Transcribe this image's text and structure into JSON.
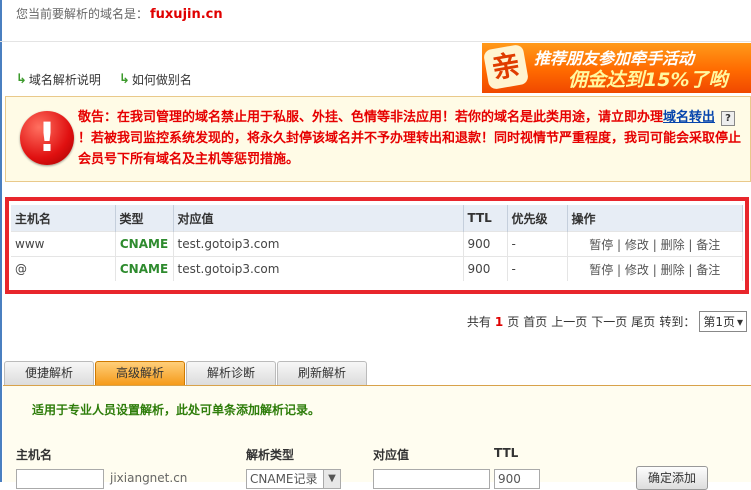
{
  "header": {
    "domain_prefix": "您当前要解析的域名是：",
    "domain": "fuxujin.cn"
  },
  "help_links": [
    {
      "label": "域名解析说明"
    },
    {
      "label": "如何做别名"
    }
  ],
  "banner": {
    "badge": "亲",
    "line1": "推荐朋友参加牵手活动",
    "line2": "佣金达到15%了哟"
  },
  "warning": {
    "part1": "敬告：在我司管理的域名禁止用于私服、外挂、色情等非法应用！若你的域名是此类用途，请立即办理",
    "link": "域名转出",
    "qmark": "?",
    "part2": "！若被我司监控系统发现的，将永久封停该域名并不予办理转出和退款！同时视情节严重程度，我司可能会采取停止会员号下所有域名及主机等惩罚措施。"
  },
  "table": {
    "headers": [
      "主机名",
      "类型",
      "对应值",
      "TTL",
      "优先级",
      "操作"
    ],
    "rows": [
      {
        "host": "www",
        "type": "CNAME",
        "value": "test.gotoip3.com",
        "ttl": "900",
        "priority": "-"
      },
      {
        "host": "@",
        "type": "CNAME",
        "value": "test.gotoip3.com",
        "ttl": "900",
        "priority": "-"
      }
    ],
    "actions": {
      "pause": "暂停",
      "edit": "修改",
      "delete": "删除",
      "note": "备注",
      "sep": " | "
    }
  },
  "pager": {
    "total_prefix": "共有",
    "total": "1",
    "total_suffix": "页",
    "first": "首页",
    "prev": "上一页",
    "next": "下一页",
    "last": "尾页",
    "goto": "转到：",
    "selected": "第1页"
  },
  "tabs": [
    {
      "label": "便捷解析"
    },
    {
      "label": "高级解析"
    },
    {
      "label": "解析诊断"
    },
    {
      "label": "刷新解析"
    }
  ],
  "tip": "适用于专业人员设置解析，此处可单条添加解析记录。",
  "form": {
    "host_label": "主机名",
    "host_suffix": "jixiangnet.cn",
    "type_label": "解析类型",
    "type_value": "CNAME记录",
    "value_label": "对应值",
    "ttl_label": "TTL",
    "ttl_value": "900",
    "submit": "确定添加"
  },
  "colors": {
    "accent_red": "#e00000",
    "record_border": "#e8262c",
    "cname_green": "#2e8b2e",
    "tab_active": "#f59a1a"
  }
}
